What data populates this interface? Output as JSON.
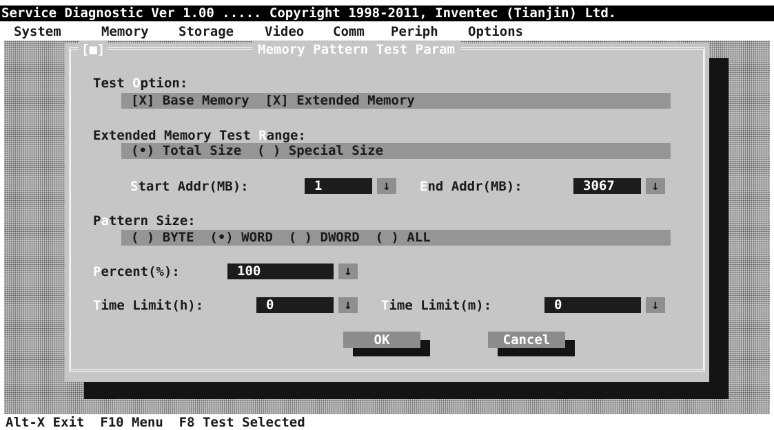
{
  "title_bar": "Service Diagnostic Ver 1.00 ..... Copyright 1998-2011, Inventec (Tianjin) Ltd.",
  "menu": [
    "System",
    "Memory",
    "Storage",
    "Video",
    "Comm",
    "Periph",
    "Options"
  ],
  "dialog": {
    "close_glyph": "[■]",
    "title": "Memory Pattern Test Param",
    "test_option": {
      "hotkey": "O",
      "label_pre": "Test ",
      "label_post": "ption:",
      "value": "[X] Base Memory  [X] Extended Memory"
    },
    "range": {
      "hotkey": "R",
      "label_pre": "Extended Memory Test ",
      "label_post": "ange:",
      "value": "(•) Total Size  ( ) Special Size"
    },
    "start_addr": {
      "hotkey": "S",
      "label": "tart Addr(MB):",
      "value": "1"
    },
    "end_addr": {
      "hotkey": "E",
      "label": "nd Addr(MB):",
      "value": "3067"
    },
    "pattern": {
      "hotkey": "a",
      "label_pre": "P",
      "label_post": "ttern Size:",
      "value": "( ) BYTE  (•) WORD  ( ) DWORD  ( ) ALL"
    },
    "percent": {
      "hotkey": "P",
      "label": "ercent(%):",
      "value": "100"
    },
    "time_h": {
      "hotkey": "T",
      "label": "ime Limit(h):",
      "value": "0"
    },
    "time_m": {
      "hotkey": "T",
      "label": "ime Limit(m):",
      "value": "0"
    },
    "dropdown_glyph": "↓",
    "ok_label": "OK",
    "cancel_label": "Cancel"
  },
  "status_bar": "Alt-X Exit  F10 Menu  F8 Test Selected"
}
